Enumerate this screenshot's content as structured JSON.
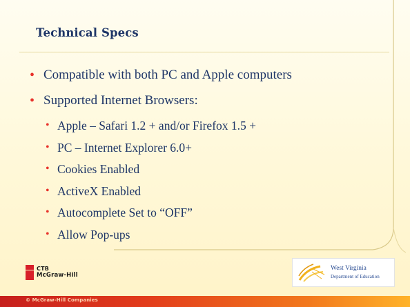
{
  "slide": {
    "title": "Technical Specs",
    "bullets": [
      {
        "text": "Compatible with both PC and Apple computers",
        "children": []
      },
      {
        "text": "Supported Internet Browsers:",
        "children": [
          "Apple – Safari 1.2 + and/or Firefox 1.5 +",
          "PC – Internet Explorer 6.0+",
          "Cookies Enabled",
          "ActiveX Enabled",
          "Autocomplete Set to “OFF”",
          "Allow Pop-ups"
        ]
      }
    ],
    "bullet_glyph": "•"
  },
  "footer": {
    "publisher_logo": {
      "line1": "CTB",
      "line2": "McGraw-Hill"
    },
    "partner_logo": {
      "line1": "West Virginia",
      "line2": "Department of Education"
    },
    "copyright": "© McGraw-Hill Companies"
  },
  "colors": {
    "accent_red": "#e8322b",
    "text_navy": "#1e3567",
    "background": "#fff8d8"
  }
}
